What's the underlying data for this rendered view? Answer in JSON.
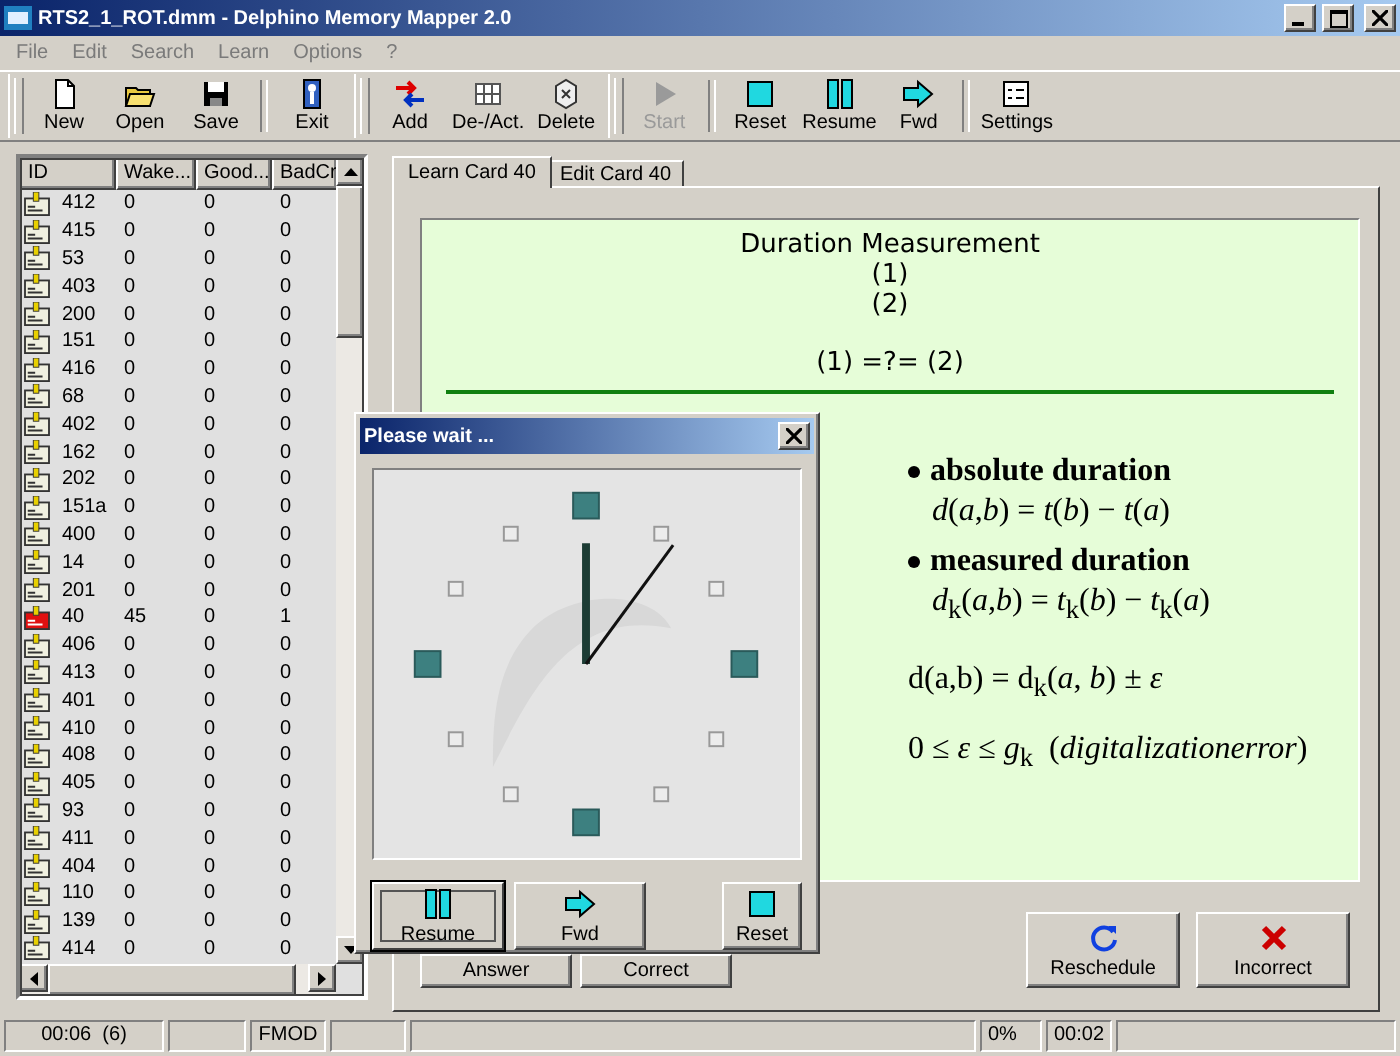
{
  "window": {
    "title": "RTS2_1_ROT.dmm - Delphino Memory Mapper 2.0"
  },
  "menu": [
    "File",
    "Edit",
    "Search",
    "Learn",
    "Options",
    "?"
  ],
  "toolbar": [
    {
      "groups": [
        [
          {
            "label": "New",
            "kind": "new",
            "disabled": false
          },
          {
            "label": "Open",
            "kind": "open",
            "disabled": false
          },
          {
            "label": "Save",
            "kind": "save",
            "disabled": false
          }
        ],
        [
          {
            "label": "Exit",
            "kind": "exit",
            "disabled": false
          }
        ]
      ]
    },
    {
      "groups": [
        [
          {
            "label": "Add",
            "kind": "add",
            "disabled": false
          },
          {
            "label": "De-/Act.",
            "kind": "toggle",
            "disabled": false
          },
          {
            "label": "Delete",
            "kind": "delete",
            "disabled": false
          }
        ]
      ]
    },
    {
      "groups": [
        [
          {
            "label": "Start",
            "kind": "start",
            "disabled": true
          }
        ],
        [
          {
            "label": "Reset",
            "kind": "reset",
            "disabled": false
          },
          {
            "label": "Resume",
            "kind": "resume",
            "disabled": false
          },
          {
            "label": "Fwd",
            "kind": "forward",
            "disabled": false
          }
        ],
        [
          {
            "label": "Settings",
            "kind": "settings",
            "disabled": false
          }
        ]
      ]
    }
  ],
  "list": {
    "columns": [
      "ID",
      "Wake...",
      "Good...",
      "BadCr"
    ],
    "rows": [
      {
        "id": "412",
        "wake": "0",
        "good": "0",
        "bad": "0",
        "flagged": false
      },
      {
        "id": "415",
        "wake": "0",
        "good": "0",
        "bad": "0",
        "flagged": false
      },
      {
        "id": "53",
        "wake": "0",
        "good": "0",
        "bad": "0",
        "flagged": false
      },
      {
        "id": "403",
        "wake": "0",
        "good": "0",
        "bad": "0",
        "flagged": false
      },
      {
        "id": "200",
        "wake": "0",
        "good": "0",
        "bad": "0",
        "flagged": false
      },
      {
        "id": "151",
        "wake": "0",
        "good": "0",
        "bad": "0",
        "flagged": false
      },
      {
        "id": "416",
        "wake": "0",
        "good": "0",
        "bad": "0",
        "flagged": false
      },
      {
        "id": "68",
        "wake": "0",
        "good": "0",
        "bad": "0",
        "flagged": false
      },
      {
        "id": "402",
        "wake": "0",
        "good": "0",
        "bad": "0",
        "flagged": false
      },
      {
        "id": "162",
        "wake": "0",
        "good": "0",
        "bad": "0",
        "flagged": false
      },
      {
        "id": "202",
        "wake": "0",
        "good": "0",
        "bad": "0",
        "flagged": false
      },
      {
        "id": "151a",
        "wake": "0",
        "good": "0",
        "bad": "0",
        "flagged": false
      },
      {
        "id": "400",
        "wake": "0",
        "good": "0",
        "bad": "0",
        "flagged": false
      },
      {
        "id": "14",
        "wake": "0",
        "good": "0",
        "bad": "0",
        "flagged": false
      },
      {
        "id": "201",
        "wake": "0",
        "good": "0",
        "bad": "0",
        "flagged": false
      },
      {
        "id": "40",
        "wake": "45",
        "good": "0",
        "bad": "1",
        "flagged": true
      },
      {
        "id": "406",
        "wake": "0",
        "good": "0",
        "bad": "0",
        "flagged": false
      },
      {
        "id": "413",
        "wake": "0",
        "good": "0",
        "bad": "0",
        "flagged": false
      },
      {
        "id": "401",
        "wake": "0",
        "good": "0",
        "bad": "0",
        "flagged": false
      },
      {
        "id": "410",
        "wake": "0",
        "good": "0",
        "bad": "0",
        "flagged": false
      },
      {
        "id": "408",
        "wake": "0",
        "good": "0",
        "bad": "0",
        "flagged": false
      },
      {
        "id": "405",
        "wake": "0",
        "good": "0",
        "bad": "0",
        "flagged": false
      },
      {
        "id": "93",
        "wake": "0",
        "good": "0",
        "bad": "0",
        "flagged": false
      },
      {
        "id": "411",
        "wake": "0",
        "good": "0",
        "bad": "0",
        "flagged": false
      },
      {
        "id": "404",
        "wake": "0",
        "good": "0",
        "bad": "0",
        "flagged": false
      },
      {
        "id": "110",
        "wake": "0",
        "good": "0",
        "bad": "0",
        "flagged": false
      },
      {
        "id": "139",
        "wake": "0",
        "good": "0",
        "bad": "0",
        "flagged": false
      },
      {
        "id": "414",
        "wake": "0",
        "good": "0",
        "bad": "0",
        "flagged": false
      }
    ]
  },
  "tabs": [
    {
      "label": "Learn Card 40",
      "selected": true
    },
    {
      "label": "Edit Card 40",
      "selected": false
    }
  ],
  "card": {
    "title": "Duration Measurement",
    "lines": [
      "(1)",
      "(2)"
    ],
    "question": "(1) =?= (2)",
    "points": [
      {
        "label": "absolute duration",
        "formula": "*d*(*a*,*b*) = *t*(*b*) − *t*(*a*)"
      },
      {
        "label": "measured duration",
        "formula": "*d*$_{k}$(*a*,*b*) = *t*$_{k}$(*b*) − *t*$_{k}$(*a*)"
      }
    ],
    "statements": [
      "d(a,b) = d$_{k}$(*a*, *b*) ± *ε*",
      "0 ≤ *ε* ≤ *g*$_{k}$  (*digitalizationerror*)"
    ]
  },
  "answer_buttons": [
    "Answer",
    "Correct"
  ],
  "grade_buttons": [
    {
      "label": "Reschedule",
      "kind": "reschedule"
    },
    {
      "label": "Incorrect",
      "kind": "incorrect"
    }
  ],
  "dialog": {
    "title": "Please wait ...",
    "buttons": [
      {
        "label": "Resume",
        "kind": "resume",
        "focused": true
      },
      {
        "label": "Fwd",
        "kind": "forward",
        "focused": false
      },
      {
        "label": "Reset",
        "kind": "reset",
        "focused": false
      }
    ]
  },
  "status_bar": {
    "elapsed": "00:06  (6)",
    "mode": "FMOD",
    "progress": "0%",
    "time": "00:02"
  }
}
